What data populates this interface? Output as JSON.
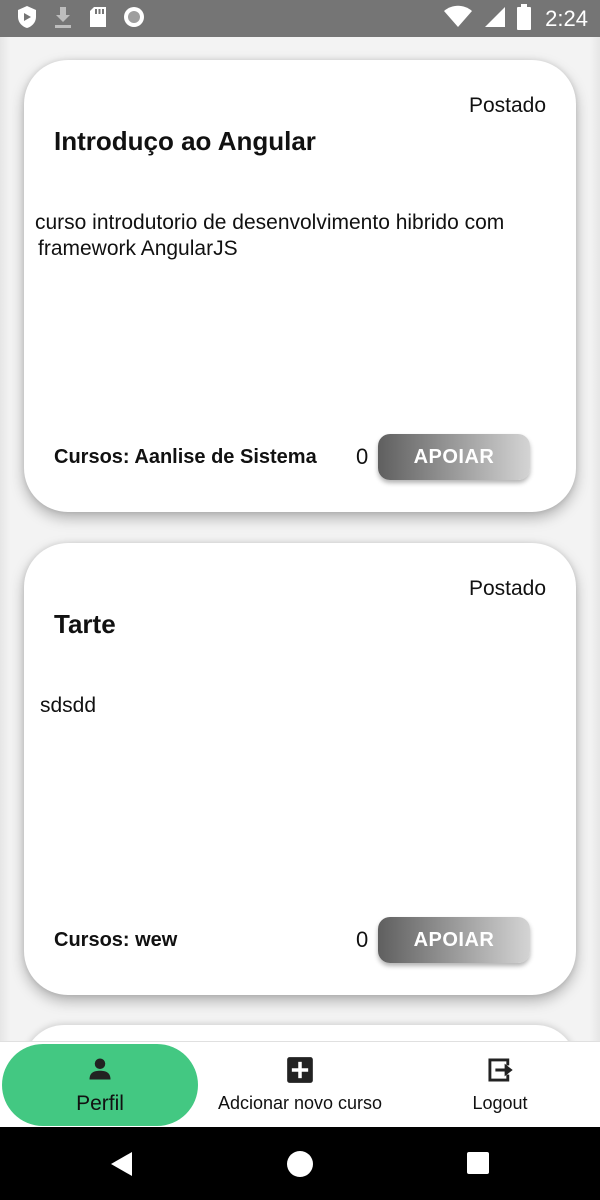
{
  "status_bar": {
    "time": "2:24",
    "icons_left": [
      "play-protect-icon",
      "download-icon",
      "sd-card-icon",
      "circle-icon"
    ],
    "icons_right": [
      "wifi-icon",
      "signal-icon",
      "battery-icon"
    ]
  },
  "cards": [
    {
      "status": "Postado",
      "title": "Introduço ao Angular",
      "description": "curso introdutorio de desenvolvimento hibrido com framework AngularJS",
      "footer_label": "Cursos: Aanlise de Sistema",
      "count": "0",
      "button_label": "APOIAR"
    },
    {
      "status": "Postado",
      "title": "Tarte",
      "description": "sdsdd",
      "footer_label": "Cursos: wew",
      "count": "0",
      "button_label": "APOIAR"
    }
  ],
  "bottom_nav": {
    "items": [
      {
        "label": "Perfil",
        "icon": "person-icon",
        "active": true
      },
      {
        "label": "Adcionar novo curso",
        "icon": "add-box-icon",
        "active": false
      },
      {
        "label": "Logout",
        "icon": "logout-icon",
        "active": false
      }
    ],
    "active_color": "#43c882"
  }
}
